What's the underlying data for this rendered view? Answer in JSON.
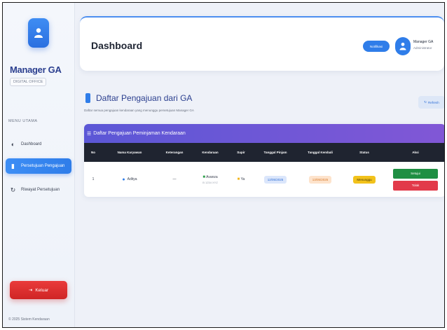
{
  "sidebar": {
    "brand": "Manager GA",
    "brand_sub": "DIGITAL OFFICE",
    "menu_label": "MENU UTAMA",
    "items": [
      {
        "label": "Dashboard",
        "icon": "gauge-icon"
      },
      {
        "label": "Persetujuan Pengajuan",
        "icon": "document-icon"
      },
      {
        "label": "Riwayat Persetujuan",
        "icon": "history-icon"
      }
    ],
    "logout": "Keluar",
    "footer": "© 2025 Sistem Kendaraan"
  },
  "header": {
    "title": "Dashboard",
    "button": "Notifikasi",
    "user_name": "Manager GA",
    "user_role": "Administrator"
  },
  "section": {
    "title": "Daftar Pengajuan dari GA",
    "subtitle": "Daftar semua pengajuan kendaraan yang menunggu persetujuan Manager GA",
    "refresh": "Refresh"
  },
  "table": {
    "caption": "Daftar Pengajuan Peminjaman Kendaraan",
    "columns": [
      "No",
      "Nama Karyawan",
      "Keterangan",
      "Kendaraan",
      "Supir",
      "Tanggal Pinjam",
      "Tanggal Kembali",
      "Status",
      "Aksi"
    ],
    "rows": [
      {
        "no": "1",
        "employee": "Aditya",
        "note": "—",
        "vehicle": "Avanza",
        "vehicle_sub": "B 1234 XYZ",
        "driver": "Ya",
        "borrow_date": "12/05/2025",
        "return_date": "13/05/2025",
        "status": "Menunggu",
        "approve": "Setujui",
        "reject": "Tolak"
      }
    ]
  },
  "colors": {
    "accent": "#2f7de9",
    "caption_start": "#5b57d6",
    "table_header": "#1f2430",
    "approve": "#1f8f43",
    "reject": "#e23a4a",
    "logout": "#d92e2e"
  }
}
